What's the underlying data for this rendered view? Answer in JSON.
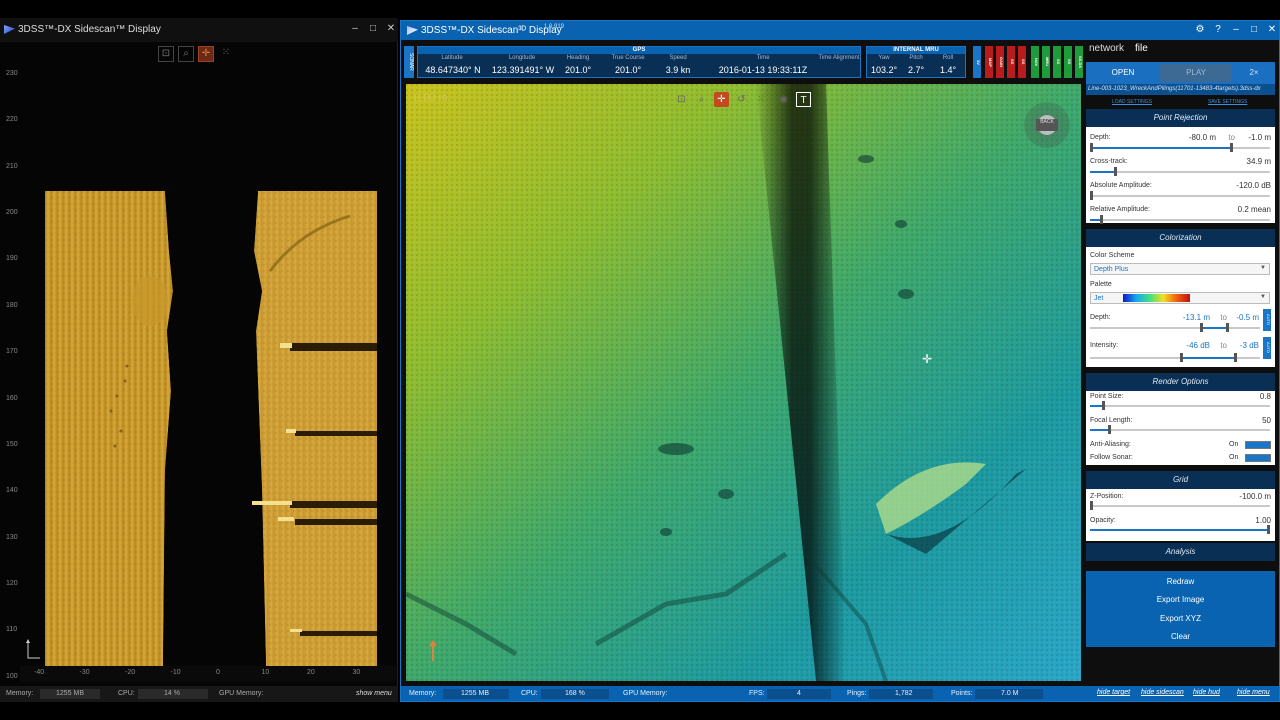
{
  "left_window": {
    "title": "3DSS™-DX Sidescan™ Display",
    "minimize": "–",
    "maximize": "□",
    "close": "✕",
    "y_ticks": [
      "230",
      "220",
      "210",
      "200",
      "190",
      "180",
      "170",
      "160",
      "150",
      "140",
      "130",
      "120",
      "110",
      "100"
    ],
    "x_ticks": [
      "-40",
      "-30",
      "-20",
      "-10",
      "0",
      "10",
      "20",
      "30"
    ],
    "status": {
      "memory_label": "Memory:",
      "memory_value": "1255 MB",
      "cpu_label": "CPU:",
      "cpu_value": "14 %",
      "gpu_label": "GPU Memory:",
      "show_menu": "show menu"
    }
  },
  "main_window": {
    "title": "3DSS™-DX Sidescan³ᴰ Display",
    "version": "1.0.919",
    "left_badge": "SONAR",
    "gps": {
      "header": "GPS",
      "fields": [
        {
          "label": "Latitude",
          "value": "48.647340° N"
        },
        {
          "label": "Longitude",
          "value": "123.391491° W"
        },
        {
          "label": "Heading",
          "value": "201.0°"
        },
        {
          "label": "True Course",
          "value": "201.0°"
        },
        {
          "label": "Speed",
          "value": "3.9 kn"
        },
        {
          "label": "Time",
          "value": "2016-01-13 19:33:11Z"
        },
        {
          "label": "Time Alignment",
          "value": ""
        }
      ]
    },
    "mru": {
      "header": "INTERNAL MRU",
      "fields": [
        {
          "label": "Yaw",
          "value": "103.2°"
        },
        {
          "label": "Pitch",
          "value": "2.7°"
        },
        {
          "label": "Roll",
          "value": "1.4°"
        }
      ]
    },
    "indicators": [
      "3V",
      "MAP",
      "GAIN",
      "SS",
      "SS",
      "NAV",
      "MRU",
      "SS",
      "SS",
      "SS.DX"
    ],
    "viewport_overlay": "0.00 m",
    "compass_label": "BACK",
    "status": {
      "memory_label": "Memory:",
      "memory_value": "1255 MB",
      "cpu_label": "CPU:",
      "cpu_value": "168 %",
      "gpu_label": "GPU Memory:",
      "fps_label": "FPS:",
      "fps_value": "4",
      "pings_label": "Pings:",
      "pings_value": "1,782",
      "points_label": "Points:",
      "points_value": "7.0 M",
      "hide_links": [
        "hide target",
        "hide sidescan",
        "hide hud",
        "hide menu"
      ]
    }
  },
  "panel": {
    "tabs": [
      "network",
      "file"
    ],
    "open": "OPEN",
    "play": "PLAY",
    "speed": "2×",
    "filename": "Line-003-1023_WreckAndPilings(11701-13483-4targets).3dss-dx",
    "load_settings": "LOAD SETTINGS",
    "save_settings": "SAVE SETTINGS",
    "point_rejection": {
      "header": "Point Rejection",
      "depth_label": "Depth:",
      "depth_from": "-80.0 m",
      "depth_to_word": "to",
      "depth_to": "-1.0 m",
      "cross_label": "Cross-track:",
      "cross_value": "34.9 m",
      "abs_label": "Absolute Amplitude:",
      "abs_value": "-120.0 dB",
      "rel_label": "Relative Amplitude:",
      "rel_value": "0.2 mean"
    },
    "colorization": {
      "header": "Colorization",
      "scheme_label": "Color Scheme",
      "scheme_value": "Depth Plus",
      "palette_label": "Palette",
      "palette_value": "Jet",
      "depth_label": "Depth:",
      "depth_from": "-13.1 m",
      "depth_to_word": "to",
      "depth_to": "-0.5 m",
      "intensity_label": "Intensity:",
      "int_from": "-46 dB",
      "int_to_word": "to",
      "int_to": "-3 dB",
      "auto": "AUTO"
    },
    "render": {
      "header": "Render Options",
      "point_label": "Point Size:",
      "point_value": "0.8",
      "focal_label": "Focal Length:",
      "focal_value": "50",
      "aa_label": "Anti-Aliasing:",
      "aa_value": "On",
      "follow_label": "Follow Sonar:",
      "follow_value": "On"
    },
    "grid": {
      "header": "Grid",
      "z_label": "Z-Position:",
      "z_value": "-100.0 m",
      "opacity_label": "Opacity:",
      "opacity_value": "1.00"
    },
    "analysis": {
      "header": "Analysis",
      "buttons": [
        "Redraw",
        "Export Image",
        "Export XYZ",
        "Clear"
      ]
    }
  },
  "colors": {
    "accent": "#1a75c6",
    "title_blue": "#0a63b0",
    "dark_blue": "#0a2f55",
    "orange": "#c24a1c"
  }
}
